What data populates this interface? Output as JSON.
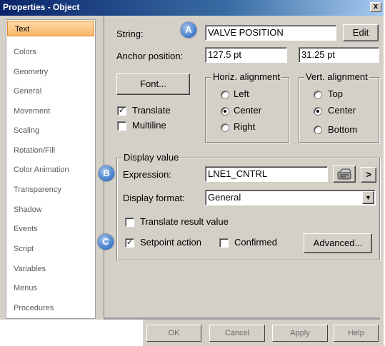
{
  "window": {
    "title": "Properties - Object",
    "close_glyph": "x"
  },
  "sidebar": {
    "items": [
      {
        "label": "Text"
      },
      {
        "label": "Colors"
      },
      {
        "label": "Geometry"
      },
      {
        "label": "General"
      },
      {
        "label": "Movement"
      },
      {
        "label": "Scaling"
      },
      {
        "label": "Rotation/Fill"
      },
      {
        "label": "Color Animation"
      },
      {
        "label": "Transparency"
      },
      {
        "label": "Shadow"
      },
      {
        "label": "Events"
      },
      {
        "label": "Script"
      },
      {
        "label": "Variables"
      },
      {
        "label": "Menus"
      },
      {
        "label": "Procedures"
      }
    ]
  },
  "text_panel": {
    "string_label": "String:",
    "string_value": "VALVE POSITION",
    "edit_button": "Edit",
    "anchor_label": "Anchor position:",
    "anchor_x": "127.5 pt",
    "anchor_y": "31.25 pt",
    "font_button": "Font...",
    "translate_label": "Translate",
    "multiline_label": "Multiline",
    "horiz_title": "Horiz. alignment",
    "horiz_left": "Left",
    "horiz_center": "Center",
    "horiz_right": "Right",
    "vert_title": "Vert. alignment",
    "vert_top": "Top",
    "vert_center": "Center",
    "vert_bottom": "Bottom"
  },
  "display_value": {
    "title": "Display value",
    "expression_label": "Expression:",
    "expression_value": "LNE1_CNTRL",
    "more_button": ">",
    "format_label": "Display format:",
    "format_value": "General",
    "translate_result_label": "Translate result value",
    "setpoint_label": "Setpoint action",
    "confirmed_label": "Confirmed",
    "advanced_button": "Advanced..."
  },
  "callouts": {
    "a": "A",
    "b": "B",
    "c": "C"
  },
  "footer": {
    "ok": "OK",
    "cancel": "Cancel",
    "apply": "Apply",
    "help": "Help"
  },
  "colors": {
    "title_bar": "#0a246a",
    "active_tab": "#f8b66a",
    "callout": "#3c78c8"
  }
}
